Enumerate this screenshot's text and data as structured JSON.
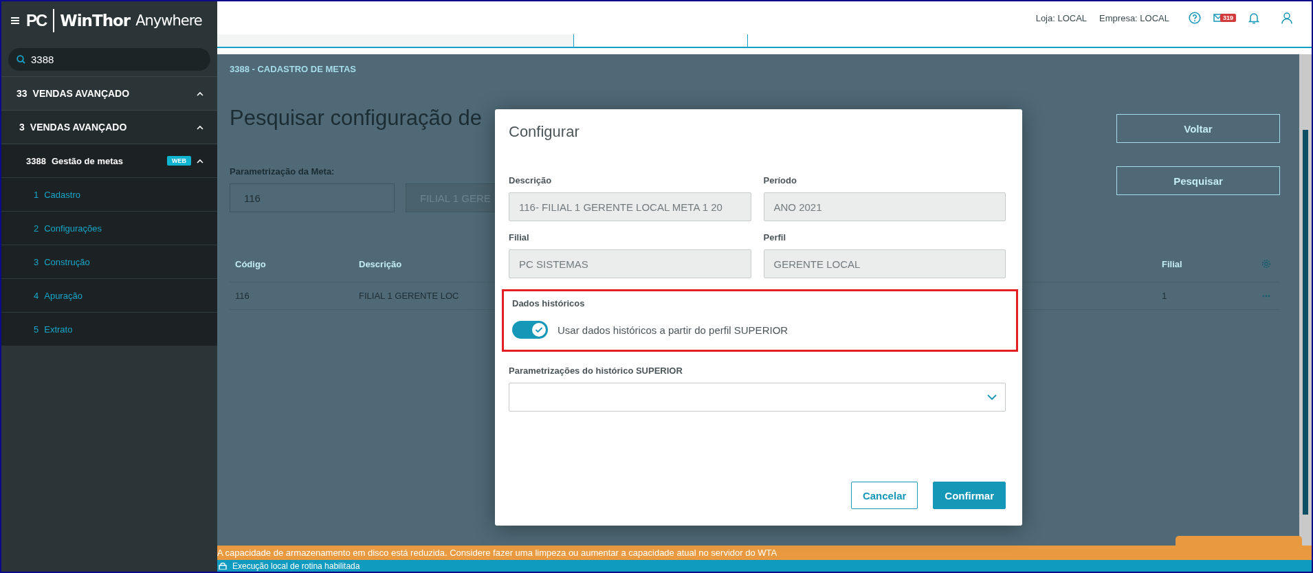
{
  "sidebar": {
    "logo": {
      "mark": "PC",
      "brand": "WinThor",
      "product": "Anywhere"
    },
    "search": {
      "value": "3388"
    },
    "menu": [
      {
        "code": "33",
        "label": "VENDAS AVANÇADO",
        "expanded": true,
        "children": [
          {
            "code": "3",
            "label": "VENDAS AVANÇADO",
            "expanded": true,
            "children": [
              {
                "code": "3388",
                "label": "Gestão de metas",
                "badge": "WEB",
                "expanded": true,
                "children": [
                  {
                    "code": "1",
                    "label": "Cadastro"
                  },
                  {
                    "code": "2",
                    "label": "Configurações"
                  },
                  {
                    "code": "3",
                    "label": "Construção"
                  },
                  {
                    "code": "4",
                    "label": "Apuração"
                  },
                  {
                    "code": "5",
                    "label": "Extrato"
                  }
                ]
              }
            ]
          }
        ]
      }
    ]
  },
  "topbar": {
    "store": "Loja: LOCAL",
    "company": "Empresa: LOCAL",
    "mail_count": "319"
  },
  "page": {
    "breadcrumb": "3388 - CADASTRO DE METAS",
    "title": "Pesquisar configuração de",
    "filter_label": "Parametrização da Meta:",
    "code_value": "116",
    "desc_value": "FILIAL 1 GERE",
    "buttons": [
      "Voltar",
      "Pesquisar"
    ],
    "table": {
      "columns": [
        "Código",
        "Descrição",
        "Filial"
      ],
      "rows": [
        [
          "116",
          "FILIAL 1 GERENTE LOC",
          "1"
        ]
      ]
    }
  },
  "dialog": {
    "title": "Configurar",
    "fields": [
      {
        "label": "Descrição",
        "value": "116- FILIAL 1 GERENTE LOCAL META 1  20"
      },
      {
        "label": "Período",
        "value": "ANO 2021"
      },
      {
        "label": "Filial",
        "value": "PC SISTEMAS"
      },
      {
        "label": "Perfil",
        "value": "GERENTE LOCAL"
      }
    ],
    "section_label": "Dados históricos",
    "toggle": {
      "label": "Usar dados históricos a partir do perfil SUPERIOR",
      "on": true
    },
    "select": {
      "label": "Parametrizações do histórico SUPERIOR"
    },
    "buttons": [
      {
        "label": "Cancelar",
        "kind": "secondary"
      },
      {
        "label": "Confirmar",
        "kind": "primary"
      }
    ]
  },
  "notices": [
    {
      "text": "A capacidade de armazenamento em disco está reduzida. Considere fazer uma limpeza ou aumentar a capacidade atual no servidor do WTA",
      "kind": "warning"
    },
    {
      "text": "Execução local de rotina habilitada",
      "kind": "info"
    }
  ]
}
